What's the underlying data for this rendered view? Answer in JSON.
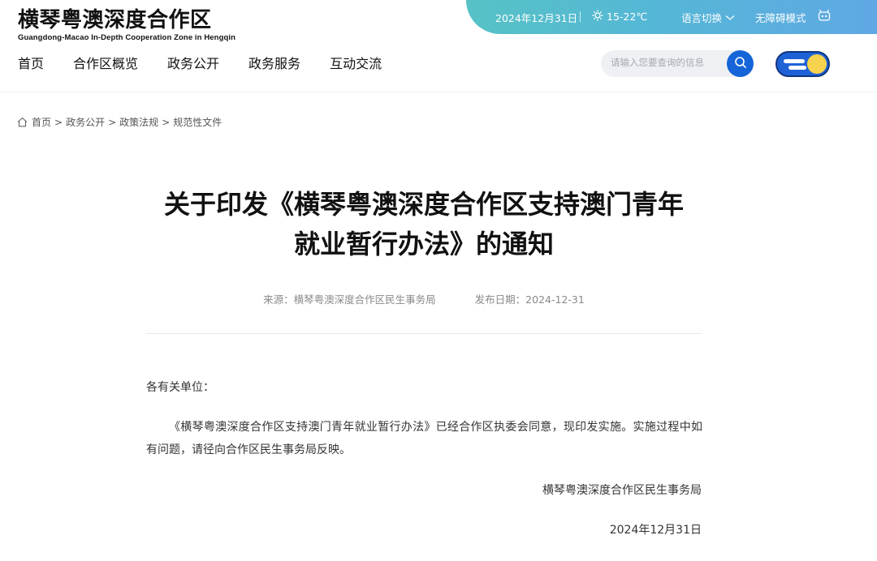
{
  "logo": {
    "cn": "横琴粤澳深度合作区",
    "en": "Guangdong-Macao In-Depth Cooperation Zone in Hengqin"
  },
  "topbar": {
    "date": "2024年12月31日",
    "weather": "15-22℃",
    "language": "语言切换",
    "accessibility": "无障碍模式"
  },
  "nav": {
    "items": [
      "首页",
      "合作区概览",
      "政务公开",
      "政务服务",
      "互动交流"
    ]
  },
  "search": {
    "placeholder": "请输入您要查询的信息"
  },
  "breadcrumb": {
    "items": [
      "首页",
      "政务公开",
      "政策法规",
      "规范性文件"
    ],
    "separator": ">"
  },
  "article": {
    "title_line1": "关于印发《横琴粤澳深度合作区支持澳门青年",
    "title_line2": "就业暂行办法》的通知",
    "source": "来源：横琴粤澳深度合作区民生事务局",
    "publish_date": "发布日期：2024-12-31",
    "salutation": "各有关单位：",
    "paragraph": "《横琴粤澳深度合作区支持澳门青年就业暂行办法》已经合作区执委会同意，现印发实施。实施过程中如有问题，请径向合作区民生事务局反映。",
    "signer": "横琴粤澳深度合作区民生事务局",
    "sign_date": "2024年12月31日"
  },
  "colors": {
    "topbar_gradient_start": "#56c2c5",
    "topbar_gradient_end": "#5fa8e4",
    "accent_blue": "#1565d8",
    "moon": "#f7d24e"
  }
}
